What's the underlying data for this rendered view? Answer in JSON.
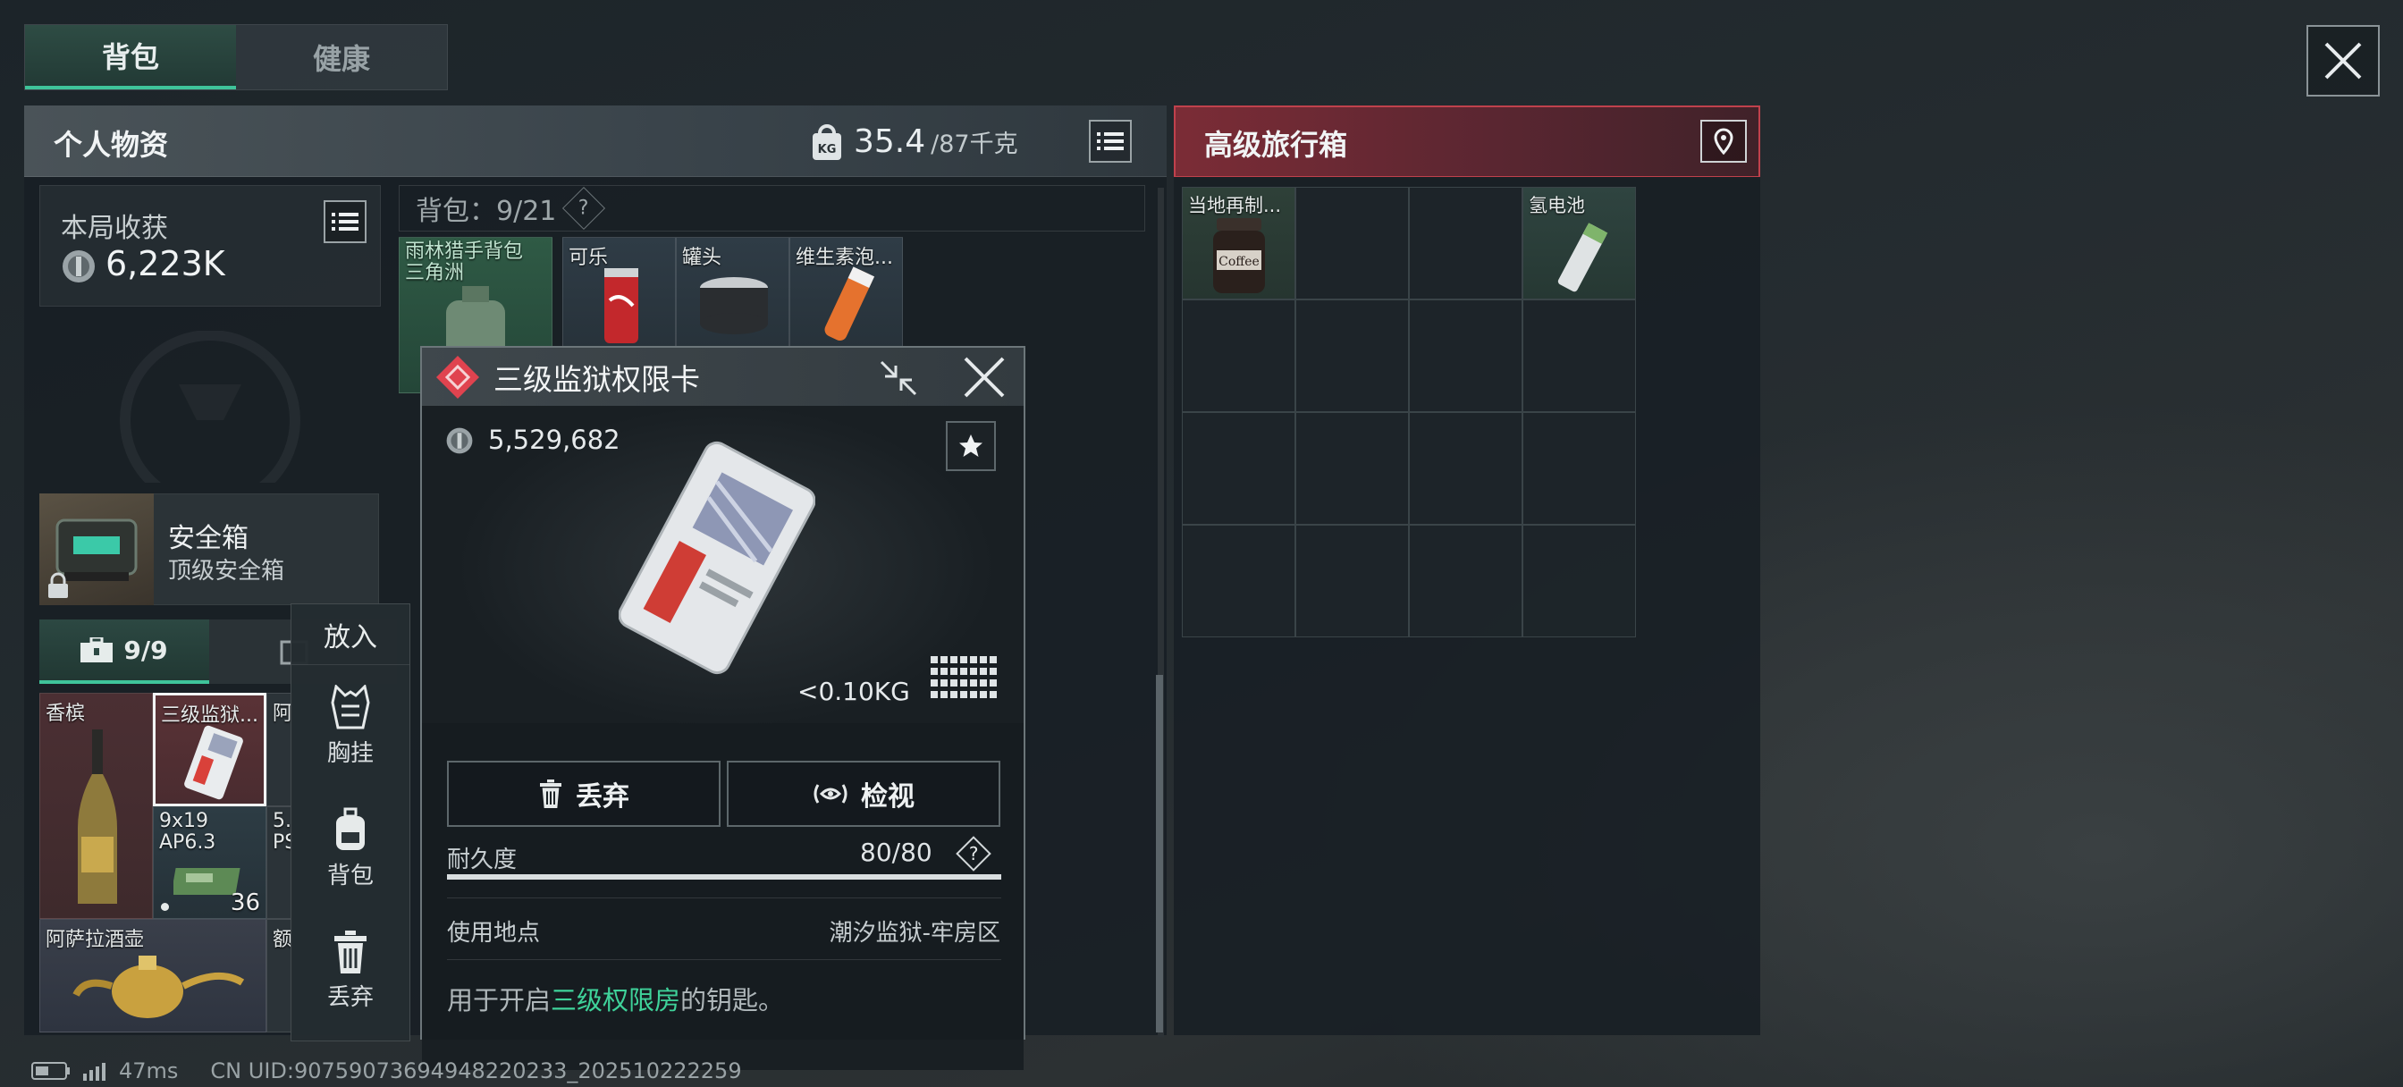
{
  "tabs": [
    {
      "label": "背包",
      "active": true
    },
    {
      "label": "健康",
      "active": false
    }
  ],
  "personal": {
    "title": "个人物资",
    "weight_current": "35.4",
    "weight_max": "/87千克",
    "earnings_label": "本局收获",
    "earnings_value": "6,223K",
    "safe_box_name": "安全箱",
    "safe_box_type": "顶级安全箱",
    "quick_count": "9/9",
    "items": [
      {
        "label": "香槟"
      },
      {
        "label": "三级监狱..."
      },
      {
        "label": "阿"
      },
      {
        "label": "9x19 AP6.3",
        "count": "36"
      },
      {
        "label": "5.56 PS"
      },
      {
        "label": "阿萨拉酒壶"
      },
      {
        "label": "额"
      }
    ]
  },
  "context_menu": {
    "title": "放入",
    "items": [
      {
        "label": "胸挂",
        "icon": "vest-icon"
      },
      {
        "label": "背包",
        "icon": "backpack-icon"
      },
      {
        "label": "丢弃",
        "icon": "trash-icon"
      }
    ]
  },
  "backpack": {
    "label": "背包：9/21",
    "help": "?",
    "items": [
      {
        "label": "雨林猎手背包 三角洲"
      },
      {
        "label": "可乐"
      },
      {
        "label": "罐头"
      },
      {
        "label": "维生素泡..."
      }
    ]
  },
  "item_detail": {
    "name": "三级监狱权限卡",
    "price": "5,529,682",
    "weight": "<0.10KG",
    "discard_label": "丢弃",
    "inspect_label": "检视",
    "durability_label": "耐久度",
    "durability_value": "80/80",
    "durability_fraction": 1.0,
    "location_label": "使用地点",
    "location_value": "潮汐监狱-牢房区",
    "desc_prefix": "用于开启",
    "desc_highlight": "三级权限房",
    "desc_suffix": "的钥匙。",
    "rarity_color": "#e0434f",
    "highlight_color": "#3fd29a"
  },
  "travel_box": {
    "title": "高级旅行箱",
    "items": [
      {
        "label": "当地再制..."
      },
      {
        "label": "氢电池"
      }
    ]
  },
  "status": {
    "ping": "47ms",
    "uid": "CN UID:90759073694948220233_202510222259"
  }
}
